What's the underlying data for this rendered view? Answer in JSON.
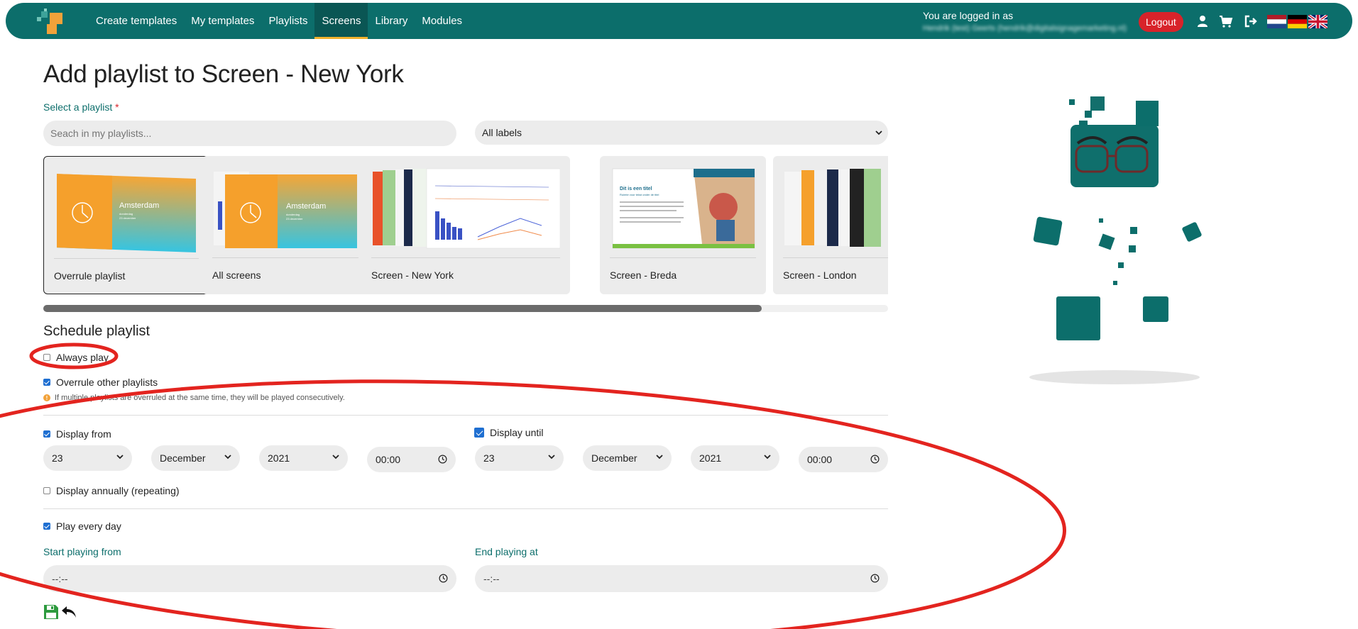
{
  "nav": {
    "links": [
      {
        "label": "Create templates",
        "active": false
      },
      {
        "label": "My templates",
        "active": false
      },
      {
        "label": "Playlists",
        "active": false
      },
      {
        "label": "Screens",
        "active": true
      },
      {
        "label": "Library",
        "active": false
      },
      {
        "label": "Modules",
        "active": false
      }
    ],
    "logged_in_text": "You are logged in as",
    "logged_in_user": "Hendrik (test) Geerts (hendrik@digitalsignagemarketing.nl)",
    "logout_label": "Logout",
    "icons": [
      "user-icon",
      "cart-icon",
      "sign-out-icon"
    ],
    "flags": [
      "flag-nl",
      "flag-de",
      "flag-uk"
    ],
    "brand_color": "#0c6e6b",
    "active_underline_color": "#f2b12d",
    "logout_color": "#d8232a"
  },
  "page": {
    "title": "Add playlist to Screen -  New York",
    "select_label": "Select a playlist",
    "required_marker": "*",
    "search_placeholder": "Seach in my playlists...",
    "labels_select_value": "All labels"
  },
  "playlists": [
    {
      "label": "Overrule playlist",
      "selected": true,
      "thumb_city": "Amsterdam",
      "thumb_sub": "donderdag",
      "thumb_date": "23 december"
    },
    {
      "label": "All screens",
      "selected": false,
      "thumb_city": "Amsterdam",
      "thumb_sub": "donderdag",
      "thumb_date": "23 december"
    },
    {
      "label": "Screen -  New York",
      "selected": false
    },
    {
      "label": "Screen -  Breda",
      "selected": false,
      "thumb_title": "Dit is een titel",
      "thumb_subtitle": "Ruimte voor tekst onder de titel"
    },
    {
      "label": "Screen -  London",
      "selected": false
    }
  ],
  "scroll_fraction": 0.85,
  "schedule": {
    "title": "Schedule playlist",
    "always_play": {
      "label": "Always play",
      "checked": false
    },
    "overrule": {
      "label": "Overrule other playlists",
      "checked": true
    },
    "info": "If multiple playlists are overruled at the same time, they will be played consecutively.",
    "display_from": {
      "label": "Display from",
      "checked": true,
      "day": "23",
      "month": "December",
      "year": "2021",
      "time": "00:00"
    },
    "display_until": {
      "label": "Display until",
      "checked": true,
      "day": "23",
      "month": "December",
      "year": "2021",
      "time": "00:00"
    },
    "annually": {
      "label": "Display annually (repeating)",
      "checked": false
    },
    "every_day": {
      "label": "Play every day",
      "checked": true
    },
    "start_label": "Start playing from",
    "start_value": "--:--",
    "end_label": "End playing at",
    "end_value": "--:--"
  },
  "actions": {
    "save": "save-icon",
    "back": "back-arrow-icon"
  },
  "annotation_color": "#e3241f"
}
